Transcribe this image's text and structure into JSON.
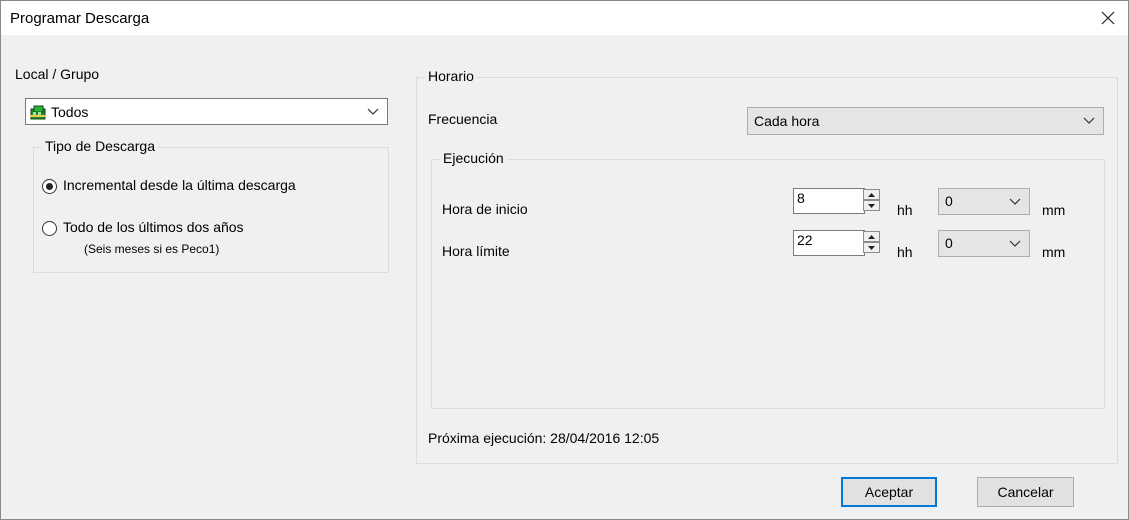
{
  "dialog": {
    "title": "Programar Descarga",
    "close_icon": "close-icon"
  },
  "left": {
    "group_label": "Local / Grupo",
    "group_select": {
      "value": "Todos",
      "icon": "group-icon"
    },
    "download_type": {
      "legend": "Tipo de Descarga",
      "options": [
        {
          "label": "Incremental desde la última descarga",
          "checked": true
        },
        {
          "label": "Todo de los últimos dos años",
          "note": "(Seis meses si es Peco1)",
          "checked": false
        }
      ]
    }
  },
  "schedule": {
    "legend": "Horario",
    "frequency_label": "Frecuencia",
    "frequency_value": "Cada hora",
    "execution": {
      "legend": "Ejecución",
      "start": {
        "label": "Hora de inicio",
        "hour": "8",
        "hour_unit": "hh",
        "minute": "0",
        "minute_unit": "mm"
      },
      "end": {
        "label": "Hora límite",
        "hour": "22",
        "hour_unit": "hh",
        "minute": "0",
        "minute_unit": "mm"
      }
    },
    "next_run": "Próxima ejecución: 28/04/2016 12:05"
  },
  "buttons": {
    "accept": "Aceptar",
    "cancel": "Cancelar"
  }
}
